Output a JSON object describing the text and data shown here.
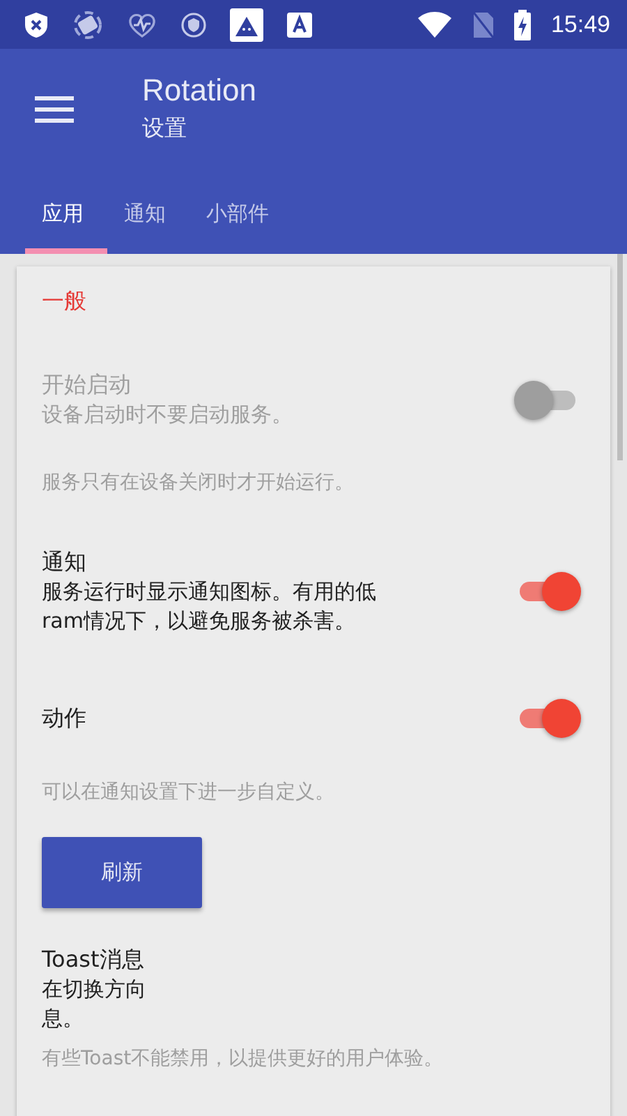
{
  "status_bar": {
    "time": "15:49"
  },
  "toolbar": {
    "title": "Rotation",
    "subtitle": "设置"
  },
  "tabs": [
    {
      "label": "应用",
      "selected": true
    },
    {
      "label": "通知",
      "selected": false
    },
    {
      "label": "小部件",
      "selected": false
    }
  ],
  "sections": [
    {
      "header": "一般",
      "items": [
        {
          "kind": "switch",
          "title": "开始启动",
          "summary": [
            "设备启动时不要启动服务。"
          ],
          "on": false,
          "disabled": true
        },
        {
          "kind": "note",
          "text": "服务只有在设备关闭时才开始运行。"
        },
        {
          "kind": "switch",
          "title": "通知",
          "summary": [
            "服务运行时显示通知图标。有用的低",
            "ram情况下，以避免服务被杀害。"
          ],
          "on": true,
          "disabled": false
        },
        {
          "kind": "switch",
          "title": "动作",
          "on": true,
          "disabled": false
        },
        {
          "kind": "note",
          "text": "可以在通知设置下进一步自定义。"
        },
        {
          "kind": "button",
          "label": "刷新"
        },
        {
          "kind": "text",
          "title": "Toast消息",
          "summary": [
            "在切换方向",
            "息。"
          ]
        },
        {
          "kind": "note",
          "text": "有些Toast不能禁用，以提供更好的用户体验。"
        }
      ]
    }
  ]
}
